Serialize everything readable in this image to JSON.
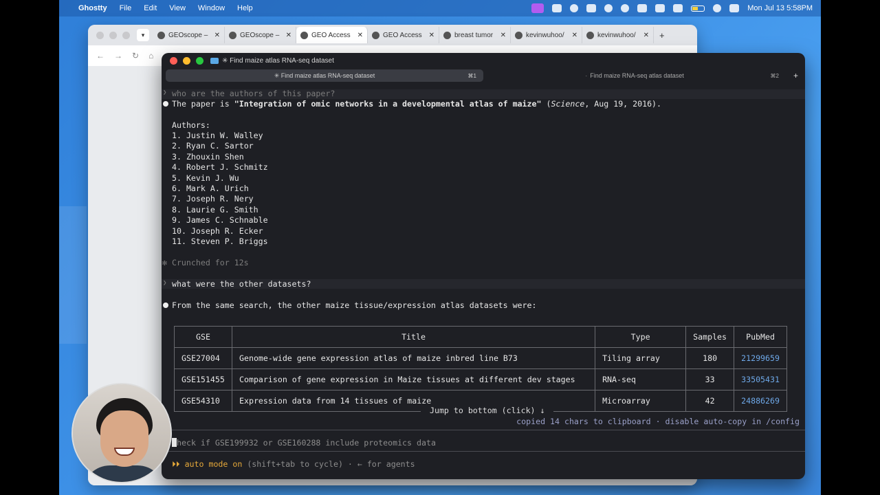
{
  "menubar": {
    "apple": "",
    "app": "Ghostty",
    "items": [
      "File",
      "Edit",
      "View",
      "Window",
      "Help"
    ],
    "datetime": "Mon Jul 13  5:58PM"
  },
  "browser": {
    "tabs": [
      {
        "title": "GEOscope –",
        "active": false
      },
      {
        "title": "GEOscope –",
        "active": false
      },
      {
        "title": "GEO Access",
        "active": true
      },
      {
        "title": "GEO Access",
        "active": false
      },
      {
        "title": "breast tumor",
        "active": false
      },
      {
        "title": "kevinwuhoo/",
        "active": false
      },
      {
        "title": "kevinwuhoo/",
        "active": false
      }
    ],
    "new_tab": "+"
  },
  "terminal": {
    "window_title": "✳ Find maize atlas RNA-seq dataset",
    "tabs": [
      {
        "label": "✳ Find maize atlas RNA-seq dataset",
        "shortcut": "⌘1",
        "active": true
      },
      {
        "label": "Find maize RNA-seq atlas dataset",
        "shortcut": "⌘2",
        "active": false
      }
    ],
    "prev_prompt": "who are the authors of this paper?",
    "answer_prefix": "The paper is ",
    "paper_title": "\"Integration of omic networks in a developmental atlas of maize\"",
    "paper_journal": "Science",
    "paper_date": ", Aug 19, 2016).",
    "authors_label": "Authors:",
    "authors": [
      "1. Justin W. Walley",
      "2. Ryan C. Sartor",
      "3. Zhouxin Shen",
      "4. Robert J. Schmitz",
      "5. Kevin J. Wu",
      "6. Mark A. Urich",
      "7. Joseph R. Nery",
      "8. Laurie G. Smith",
      "9. James C. Schnable",
      "10. Joseph R. Ecker",
      "11. Steven P. Briggs"
    ],
    "crunched": "✻ Crunched for 12s",
    "user_prompt": "what were the other datasets?",
    "response": "From the same search, the other maize tissue/expression atlas datasets were:",
    "table": {
      "headers": [
        "GSE",
        "Title",
        "Type",
        "Samples",
        "PubMed"
      ],
      "rows": [
        [
          "GSE27004",
          "Genome-wide gene expression atlas of maize inbred line B73",
          "Tiling array",
          "180",
          "21299659"
        ],
        [
          "GSE151455",
          "Comparison of gene expression in Maize tissues at different dev stages",
          "RNA-seq",
          "33",
          "33505431"
        ],
        [
          "GSE54310",
          "Expression data from 14 tissues of maize",
          "Microarray",
          "42",
          "24886269"
        ]
      ]
    },
    "jump_label": " Jump to bottom (click) ↓ ",
    "copied_notice": "copied 14 chars to clipboard · disable auto-copy in /config",
    "input_value": "heck if GSE199932 or GSE160288 include proteomics data",
    "input_first_char": "c",
    "auto_mode_prefix": "⏵⏵ auto mode on",
    "auto_mode_suffix": " (shift+tab to cycle) · ← for agents"
  },
  "colors": {
    "terminal_bg": "#1e1f24",
    "link": "#6ea8e8",
    "auto_mode": "#e6a93a"
  }
}
